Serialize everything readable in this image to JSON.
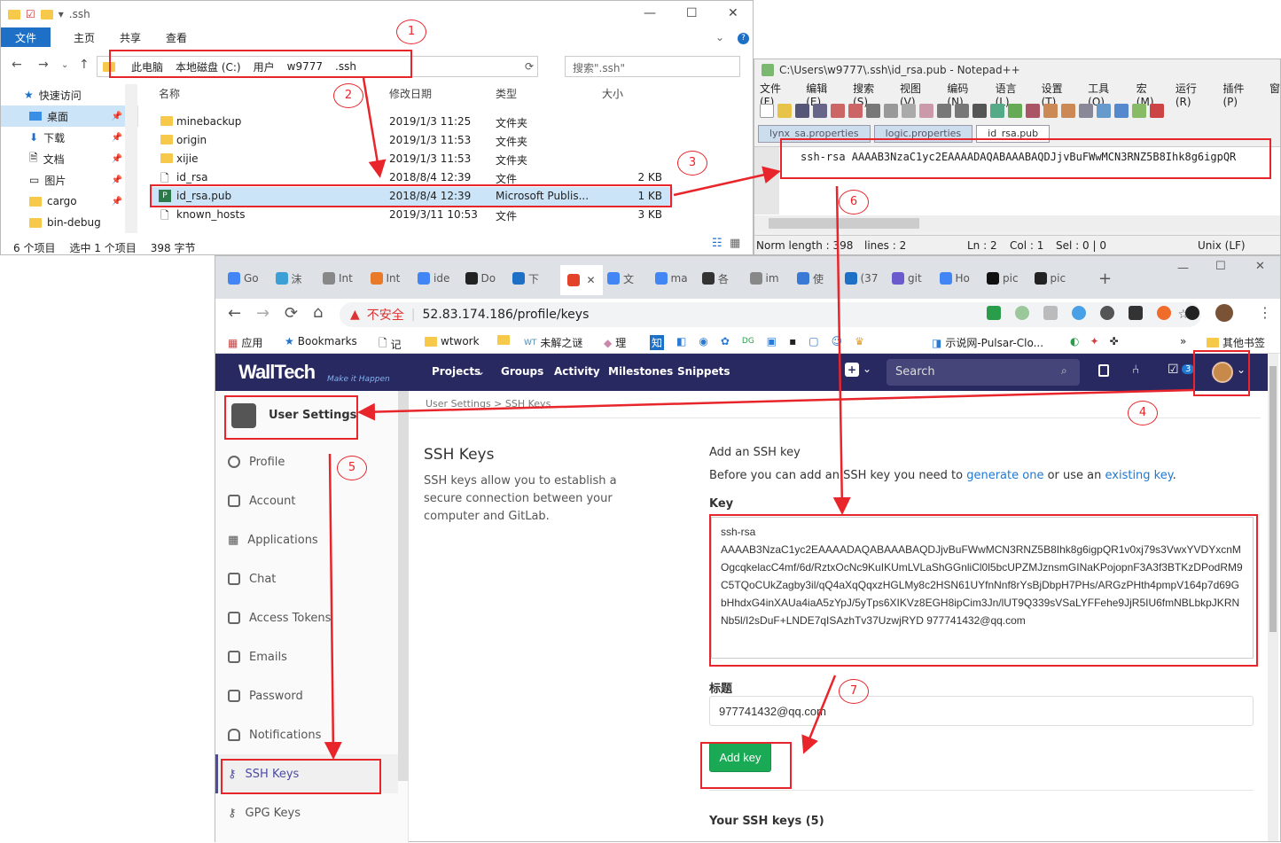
{
  "explorer": {
    "title": ".ssh",
    "ribbon": [
      "文件",
      "主页",
      "共享",
      "查看"
    ],
    "path": [
      "此电脑",
      "本地磁盘 (C:)",
      "用户",
      "w9777",
      ".ssh"
    ],
    "search_placeholder": "搜索\".ssh\"",
    "nav": [
      {
        "label": "快速访问"
      },
      {
        "label": "桌面"
      },
      {
        "label": "下载"
      },
      {
        "label": "文档"
      },
      {
        "label": "图片"
      },
      {
        "label": "cargo"
      },
      {
        "label": "bin-debug"
      }
    ],
    "columns": {
      "name": "名称",
      "date": "修改日期",
      "type": "类型",
      "size": "大小"
    },
    "files": [
      {
        "name": "minebackup",
        "date": "2019/1/3 11:25",
        "type": "文件夹",
        "size": ""
      },
      {
        "name": "origin",
        "date": "2019/1/3 11:53",
        "type": "文件夹",
        "size": ""
      },
      {
        "name": "xijie",
        "date": "2019/1/3 11:53",
        "type": "文件夹",
        "size": ""
      },
      {
        "name": "id_rsa",
        "date": "2018/8/4 12:39",
        "type": "文件",
        "size": "2 KB"
      },
      {
        "name": "id_rsa.pub",
        "date": "2018/8/4 12:39",
        "type": "Microsoft Publis...",
        "size": "1 KB"
      },
      {
        "name": "known_hosts",
        "date": "2019/3/11 10:53",
        "type": "文件",
        "size": "3 KB"
      }
    ],
    "status": {
      "count": "6 个项目",
      "selected": "选中 1 个项目",
      "bytes": "398 字节"
    }
  },
  "notepad": {
    "title": "C:\\Users\\w9777\\.ssh\\id_rsa.pub - Notepad++",
    "menu": [
      "文件(F)",
      "编辑(E)",
      "搜索(S)",
      "视图(V)",
      "编码(N)",
      "语言(L)",
      "设置(T)",
      "工具(O)",
      "宏(M)",
      "运行(R)",
      "插件(P)",
      "窗"
    ],
    "tabs": [
      "lynx_sa.properties",
      "logic.properties",
      "id_rsa.pub"
    ],
    "content": "ssh-rsa AAAAB3NzaC1yc2EAAAADAQABAAABAQDJjvBuFWwMCN3RNZ5B8Ihk8g6igpQR",
    "status": {
      "length": "Norm length : 398",
      "lines": "lines : 2",
      "ln": "Ln : 2",
      "col": "Col : 1",
      "sel": "Sel : 0 | 0",
      "eol": "Unix (LF)"
    }
  },
  "chrome": {
    "tabs": [
      "Go",
      "沫",
      "Int",
      "Int",
      "ide",
      "Do",
      "下",
      "",
      "文",
      "ma",
      "各",
      "im",
      "使",
      "(37",
      "git",
      "Ho",
      "pic",
      "pic"
    ],
    "insecure": "不安全",
    "url": "52.83.174.186/profile/keys",
    "bookmarks": [
      "应用",
      "Bookmarks",
      "记",
      "wtwork",
      "",
      "未解之谜",
      "理",
      "知",
      "示说网-Pulsar-Clo...",
      "其他书签"
    ]
  },
  "gitlab": {
    "logo": "WallTech",
    "logo_sub": "Make it Happen",
    "nav": [
      "Projects",
      "Groups",
      "Activity",
      "Milestones",
      "Snippets"
    ],
    "search_placeholder": "Search",
    "todo_count": "3",
    "settings_title": "User Settings",
    "breadcrumb": "User Settings > SSH Keys",
    "sidebar": [
      "Profile",
      "Account",
      "Applications",
      "Chat",
      "Access Tokens",
      "Emails",
      "Password",
      "Notifications",
      "SSH Keys",
      "GPG Keys"
    ],
    "heading": "SSH Keys",
    "description": "SSH keys allow you to establish a secure connection between your computer and GitLab.",
    "add_title": "Add an SSH key",
    "add_text_1": "Before you can add an SSH key you need to",
    "add_link_1": "generate one",
    "add_text_2": "or use an",
    "add_link_2": "existing key",
    "key_label": "Key",
    "key_value": "ssh-rsa\nAAAAB3NzaC1yc2EAAAADAQABAAABAQDJjvBuFWwMCN3RNZ5B8Ihk8g6igpQR1v0xj79s3VwxYVDYxcnMOgcqkelacC4mf/6d/RztxOcNc9KuIKUmLVLaShGGnliCl0l5bcUPZMJznsmGINaKPojopnF3A3f3BTKzDPodRM9C5TQoCUkZagby3il/qQ4aXqQqxzHGLMy8c2HSN61UYfnNnf8rYsBjDbpH7PHs/ARGzPHth4pmpV164p7d69GbHhdxG4inXAUa4iaA5zYpJ/5yTps6XIKVz8EGH8ipCim3Jn/lUT9Q339sVSaLYFFehe9JjR5IU6fmNBLbkpJKRNNb5l/I2sDuF+LNDE7qISAzhTv37UzwjRYD 977741432@qq.com",
    "title_label": "标题",
    "title_value": "977741432@qq.com",
    "add_button": "Add key",
    "your_keys": "Your SSH keys (5)"
  },
  "annotations": [
    "1",
    "2",
    "3",
    "4",
    "5",
    "6",
    "7"
  ]
}
